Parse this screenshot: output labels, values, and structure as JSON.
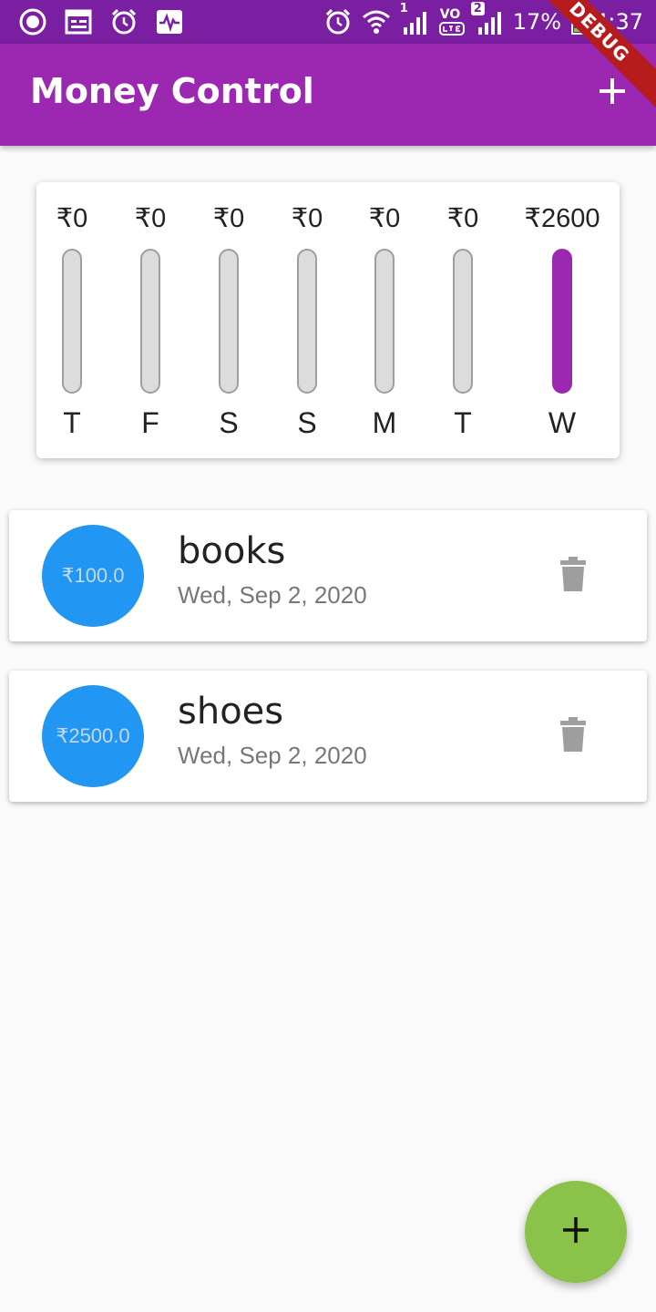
{
  "status_bar": {
    "battery": "17%",
    "time": "4:37",
    "sim_badge_1": "1",
    "sim_badge_2": "2",
    "volte": "VO"
  },
  "app_bar": {
    "title": "Money Control",
    "add_icon": "plus-icon"
  },
  "debug_banner": "DEBUG",
  "colors": {
    "primary": "#9c27b0",
    "status_bar": "#7b1fa2",
    "amount_circle": "#2196f3",
    "fab": "#8bc34a",
    "bar_empty": "#dcdcdc"
  },
  "chart_data": {
    "type": "bar",
    "categories": [
      "T",
      "F",
      "S",
      "S",
      "M",
      "T",
      "W"
    ],
    "labels": [
      "₹0",
      "₹0",
      "₹0",
      "₹0",
      "₹0",
      "₹0",
      "₹2600"
    ],
    "values": [
      0,
      0,
      0,
      0,
      0,
      0,
      2600
    ],
    "fractions": [
      0,
      0,
      0,
      0,
      0,
      0,
      1.0
    ]
  },
  "transactions": [
    {
      "amount": "₹100.0",
      "title": "books",
      "date": "Wed, Sep 2, 2020",
      "delete_icon": "trash-icon"
    },
    {
      "amount": "₹2500.0",
      "title": "shoes",
      "date": "Wed, Sep 2, 2020",
      "delete_icon": "trash-icon"
    }
  ],
  "fab": {
    "icon": "plus-icon"
  }
}
